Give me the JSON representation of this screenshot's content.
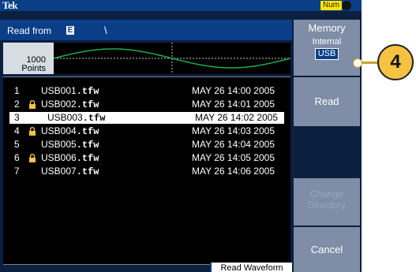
{
  "header": {
    "brand": "Tek",
    "num_indicator": "Num"
  },
  "read_bar": {
    "label": "Read from",
    "drive_letter": "E",
    "path": "\\"
  },
  "preview": {
    "points_count": "1000",
    "points_label": "Points"
  },
  "files": [
    {
      "index": "1",
      "name": "USB001",
      "ext": ".tfw",
      "date": "MAY 26 14:00 2005",
      "locked": false,
      "selected": false
    },
    {
      "index": "2",
      "name": "USB002",
      "ext": ".tfw",
      "date": "MAY 26 14:01 2005",
      "locked": true,
      "selected": false
    },
    {
      "index": "3",
      "name": "USB003",
      "ext": ".tfw",
      "date": "MAY 26 14:02 2005",
      "locked": false,
      "selected": true
    },
    {
      "index": "4",
      "name": "USB004",
      "ext": ".tfw",
      "date": "MAY 26 14:03 2005",
      "locked": true,
      "selected": false
    },
    {
      "index": "5",
      "name": "USB005",
      "ext": ".tfw",
      "date": "MAY 26 14:04 2005",
      "locked": false,
      "selected": false
    },
    {
      "index": "6",
      "name": "USB006",
      "ext": ".tfw",
      "date": "MAY 26 14:05 2005",
      "locked": true,
      "selected": false
    },
    {
      "index": "7",
      "name": "USB007",
      "ext": ".tfw",
      "date": "MAY 26 14:06 2005",
      "locked": false,
      "selected": false
    }
  ],
  "footer": {
    "tab_label": "Read Waveform"
  },
  "softkeys": {
    "memory": {
      "title": "Memory",
      "line2": "Internal",
      "badge": "USB"
    },
    "read": "Read",
    "change_directory": {
      "line1": "Change",
      "line2": "Directory"
    },
    "cancel": "Cancel"
  },
  "callout": {
    "number": "4"
  },
  "colors": {
    "screen_background": "#0b1f3f",
    "accent_blue": "#0a3e86",
    "softkey_grey": "#7f8da6",
    "waveform_green": "#18b04a",
    "callout_gold": "#f5c242"
  },
  "icons": {
    "lock": "lock-icon",
    "record_indicator": "record-dot-icon"
  }
}
